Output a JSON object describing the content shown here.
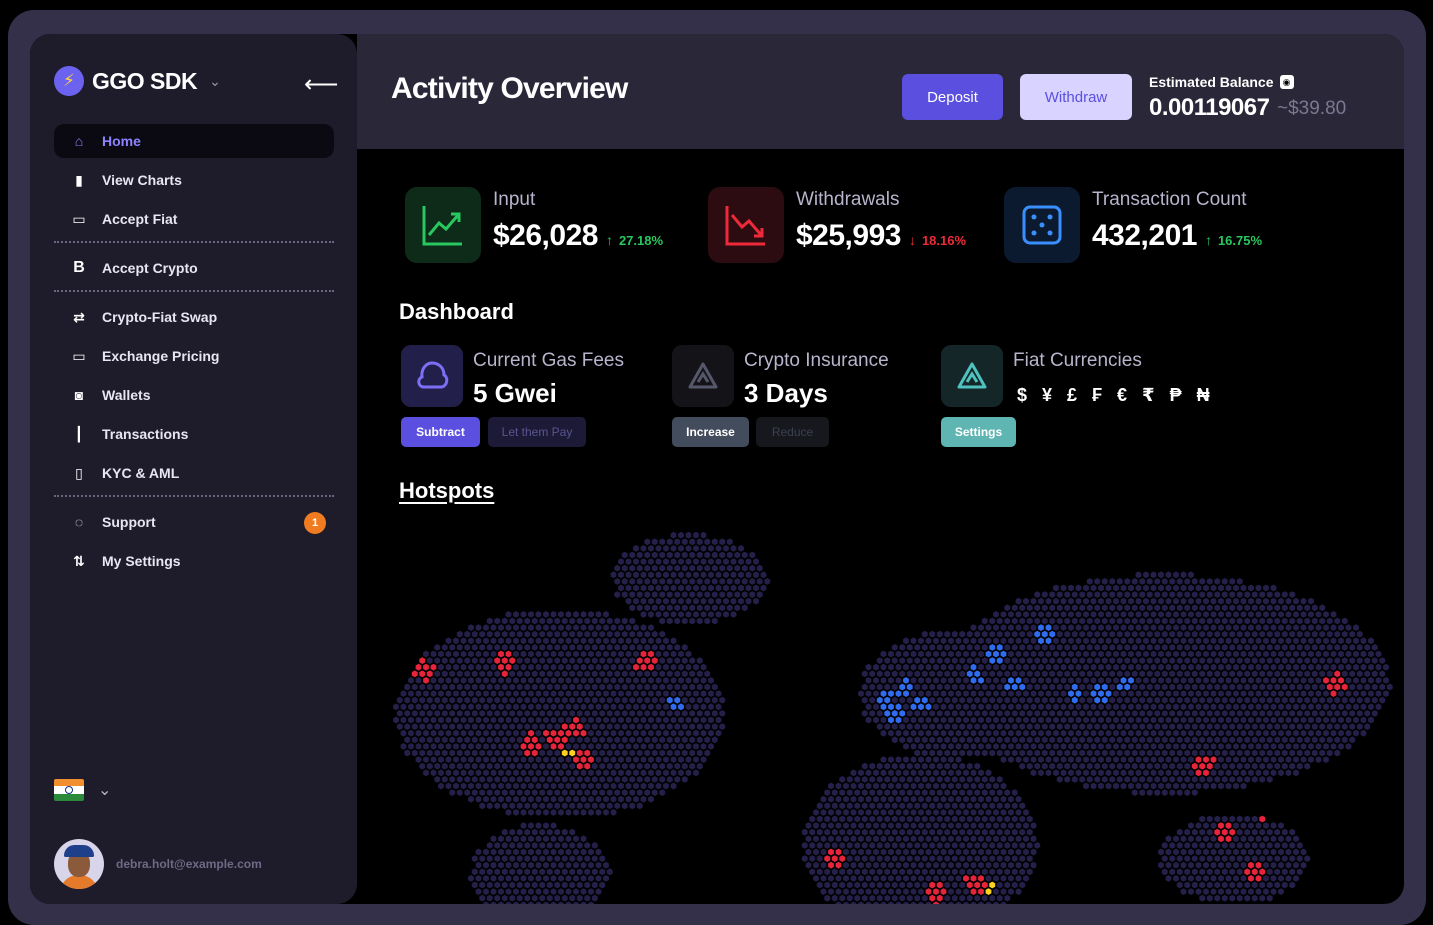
{
  "brand": {
    "name": "GGO SDK"
  },
  "sidebar": {
    "items": [
      {
        "label": "Home",
        "icon": "home-icon",
        "active": true
      },
      {
        "label": "View Charts",
        "icon": "bar-chart-icon"
      },
      {
        "label": "Accept Fiat",
        "icon": "card-icon"
      },
      {
        "label": "Accept Crypto",
        "icon": "bitcoin-icon"
      },
      {
        "label": "Crypto-Fiat Swap",
        "icon": "swap-icon"
      },
      {
        "label": "Exchange Pricing",
        "icon": "monitor-icon"
      },
      {
        "label": "Wallets",
        "icon": "wallet-icon"
      },
      {
        "label": "Transactions",
        "icon": "transactions-icon"
      },
      {
        "label": "KYC & AML",
        "icon": "document-icon"
      },
      {
        "label": "Support",
        "icon": "support-icon",
        "badge": "1"
      },
      {
        "label": "My Settings",
        "icon": "settings-icon"
      }
    ]
  },
  "user": {
    "email": "debra.holt@example.com"
  },
  "header": {
    "title": "Activity Overview",
    "deposit_label": "Deposit",
    "withdraw_label": "Withdraw",
    "balance_label": "Estimated Balance",
    "balance_value": "0.00119067",
    "balance_usd": "~$39.80"
  },
  "stats": [
    {
      "label": "Input",
      "value": "$26,028",
      "arrow": "↑",
      "pct": "27.18%",
      "trend": "up",
      "color": "#28c75f"
    },
    {
      "label": "Withdrawals",
      "value": "$25,993",
      "arrow": "↓",
      "pct": "18.16%",
      "trend": "down",
      "color": "#ee2a3a"
    },
    {
      "label": "Transaction Count",
      "value": "432,201",
      "arrow": "↑",
      "pct": "16.75%",
      "trend": "up",
      "color": "#3a8fff"
    }
  ],
  "dashboard": {
    "title": "Dashboard",
    "gas": {
      "label": "Current Gas Fees",
      "value": "5 Gwei",
      "btn1": "Subtract",
      "btn2": "Let them Pay"
    },
    "insurance": {
      "label": "Crypto Insurance",
      "value": "3 Days",
      "btn1": "Increase",
      "btn2": "Reduce"
    },
    "fiat": {
      "label": "Fiat Currencies",
      "symbols": "$ ¥ £ ₣ € ₹ ₱ ₦",
      "btn1": "Settings"
    }
  },
  "hotspots": {
    "title": "Hotspots"
  },
  "colors": {
    "accent": "#5b4fe0",
    "up": "#28c75f",
    "down": "#ee2a3a",
    "hex_base": "#24204a",
    "hex_red": "#e8243c",
    "hex_blue": "#2f6cf0",
    "hex_yellow": "#ffd21f"
  }
}
